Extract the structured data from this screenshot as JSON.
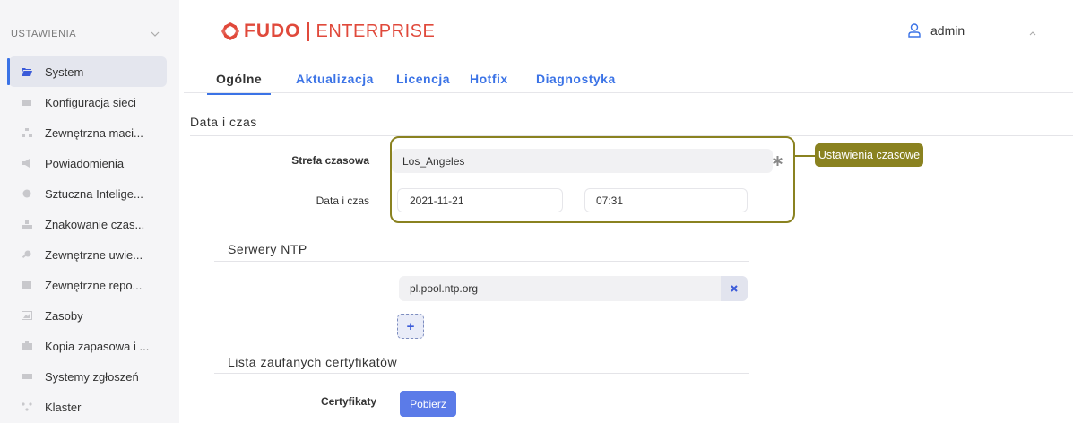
{
  "sidebar": {
    "title": "USTAWIENIA",
    "items": [
      {
        "label": "System",
        "icon": "folder-icon",
        "active": true
      },
      {
        "label": "Konfiguracja sieci",
        "icon": "network-icon"
      },
      {
        "label": "Zewnętrzna maci...",
        "icon": "sitemap-icon"
      },
      {
        "label": "Powiadomienia",
        "icon": "megaphone-icon"
      },
      {
        "label": "Sztuczna Intelige...",
        "icon": "brain-icon"
      },
      {
        "label": "Znakowanie czas...",
        "icon": "stamp-icon"
      },
      {
        "label": "Zewnętrzne uwie...",
        "icon": "key-icon"
      },
      {
        "label": "Zewnętrzne repo...",
        "icon": "archive-icon"
      },
      {
        "label": "Zasoby",
        "icon": "image-icon"
      },
      {
        "label": "Kopia zapasowa i ...",
        "icon": "briefcase-icon"
      },
      {
        "label": "Systemy zgłoszeń",
        "icon": "ticket-icon"
      },
      {
        "label": "Klaster",
        "icon": "cluster-icon"
      }
    ]
  },
  "header": {
    "logo_main": "FUDO",
    "logo_sub": "ENTERPRISE",
    "user": "admin"
  },
  "tabs": [
    "Ogólne",
    "Aktualizacja",
    "Licencja",
    "Hotfix",
    "Diagnostyka"
  ],
  "datetime": {
    "section_title": "Data i czas",
    "timezone_label": "Strefa czasowa",
    "timezone_value": "Los_Angeles",
    "date_label": "Data i czas",
    "date_value": "2021-11-21",
    "time_value": "07:31",
    "callout": "Ustawienia czasowe"
  },
  "ntp": {
    "section_title": "Serwery NTP",
    "servers": [
      "pl.pool.ntp.org"
    ],
    "add_symbol": "+"
  },
  "certs": {
    "section_title": "Lista zaufanych certyfikatów",
    "label": "Certyfikaty",
    "button": "Pobierz"
  },
  "colors": {
    "accent": "#3b73e6",
    "brand": "#e0493b",
    "callout": "#8a8220",
    "primary_button": "#5b7be8"
  }
}
